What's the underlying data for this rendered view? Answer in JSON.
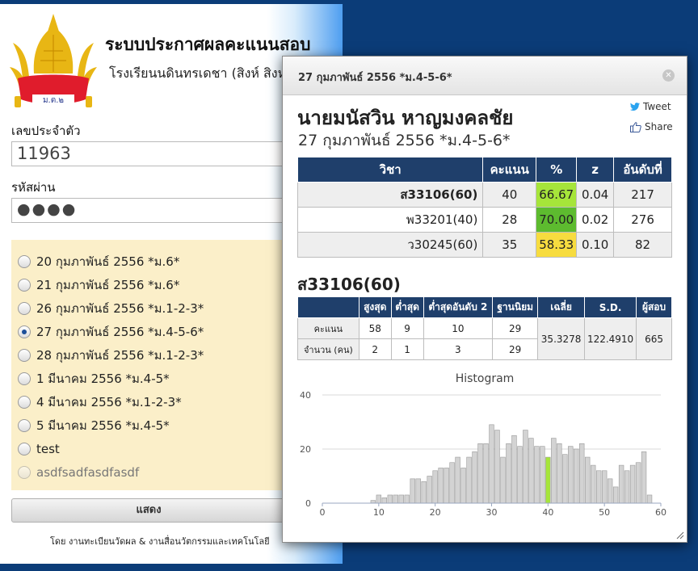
{
  "site": {
    "title": "ระบบประกาศผลคะแนนสอบ",
    "school": "โรงเรียนนดินทรเดชา (สิงห์ สิงหเสนี)",
    "logo_text": "ม.ต.๒"
  },
  "login": {
    "id_label": "เลขประจำตัว",
    "id_value": "11963",
    "password_label": "รหัสผ่าน",
    "password_value": "●●●●"
  },
  "exams": [
    {
      "label": "20 กุมภาพันธ์ 2556 *ม.6*",
      "checked": false,
      "disabled": false
    },
    {
      "label": "21 กุมภาพันธ์ 2556 *ม.6*",
      "checked": false,
      "disabled": false
    },
    {
      "label": "26 กุมภาพันธ์ 2556 *ม.1-2-3*",
      "checked": false,
      "disabled": false
    },
    {
      "label": "27 กุมภาพันธ์ 2556 *ม.4-5-6*",
      "checked": true,
      "disabled": false
    },
    {
      "label": "28 กุมภาพันธ์ 2556 *ม.1-2-3*",
      "checked": false,
      "disabled": false
    },
    {
      "label": "1 มีนาคม 2556 *ม.4-5*",
      "checked": false,
      "disabled": false
    },
    {
      "label": "4 มีนาคม 2556 *ม.1-2-3*",
      "checked": false,
      "disabled": false
    },
    {
      "label": "5 มีนาคม 2556 *ม.4-5*",
      "checked": false,
      "disabled": false
    },
    {
      "label": "test",
      "checked": false,
      "disabled": false
    },
    {
      "label": "asdfsadfasdfasdf",
      "checked": false,
      "disabled": true
    }
  ],
  "show_button": "แสดง",
  "footer": "โดย งานทะเบียนวัดผล & งานสื่อนวัตกรรมและเทคโนโลยี",
  "modal": {
    "title": "27 กุมภาพันธ์ 2556 *ม.4-5-6*",
    "close_icon": "close-icon",
    "student_name": "นายมนัสวิน หาญมงคลชัย",
    "exam_subtitle": "27 กุมภาพันธ์ 2556 *ม.4-5-6*",
    "tweet_label": "Tweet",
    "share_label": "Share",
    "score_headers": [
      "วิชา",
      "คะแนน",
      "%",
      "z",
      "อันดับที่"
    ],
    "scores": [
      {
        "subject": "ส33106(60)",
        "score": "40",
        "percent": "66.67",
        "z": "0.04",
        "rank": "217",
        "percent_color": "#a6e53a",
        "bold": true
      },
      {
        "subject": "พ33201(40)",
        "score": "28",
        "percent": "70.00",
        "z": "0.02",
        "rank": "276",
        "percent_color": "#5dbb2f",
        "bold": false
      },
      {
        "subject": "ว30245(60)",
        "score": "35",
        "percent": "58.33",
        "z": "0.10",
        "rank": "82",
        "percent_color": "#f7dc3f",
        "bold": false
      }
    ],
    "stats_title": "ส33106(60)",
    "stats_headers": [
      "",
      "สูงสุด",
      "ต่ำสุด",
      "ต่ำสุดอันดับ 2",
      "ฐานนิยม",
      "เฉลี่ย",
      "S.D.",
      "ผู้สอบ"
    ],
    "stats_rows": [
      {
        "label": "คะแนน",
        "values": [
          "58",
          "9",
          "10",
          "29"
        ]
      },
      {
        "label": "จำนวน (คน)",
        "values": [
          "2",
          "1",
          "3",
          "29"
        ]
      }
    ],
    "stats_merged": [
      "35.3278",
      "122.4910",
      "665"
    ]
  },
  "chart_data": {
    "type": "bar",
    "title": "Histogram",
    "xlabel": "",
    "ylabel": "",
    "xlim": [
      0,
      60
    ],
    "ylim": [
      0,
      40
    ],
    "x_ticks": [
      "0",
      "10",
      "20",
      "30",
      "40",
      "50",
      "60"
    ],
    "y_ticks": [
      "0",
      "20",
      "40"
    ],
    "grid": true,
    "highlight_x": 40,
    "highlight_color": "#a6e53a",
    "bar_color": "#d3d3d3",
    "x": [
      9,
      10,
      11,
      12,
      13,
      14,
      15,
      16,
      17,
      18,
      19,
      20,
      21,
      22,
      23,
      24,
      25,
      26,
      27,
      28,
      29,
      30,
      31,
      32,
      33,
      34,
      35,
      36,
      37,
      38,
      39,
      40,
      41,
      42,
      43,
      44,
      45,
      46,
      47,
      48,
      49,
      50,
      51,
      52,
      53,
      54,
      55,
      56,
      57,
      58
    ],
    "values": [
      1,
      3,
      2,
      3,
      3,
      3,
      3,
      9,
      9,
      8,
      10,
      12,
      13,
      13,
      15,
      17,
      13,
      17,
      19,
      22,
      22,
      29,
      27,
      17,
      22,
      25,
      21,
      27,
      24,
      21,
      21,
      17,
      24,
      22,
      18,
      21,
      20,
      22,
      17,
      14,
      12,
      12,
      9,
      6,
      14,
      12,
      14,
      15,
      19,
      3
    ]
  }
}
